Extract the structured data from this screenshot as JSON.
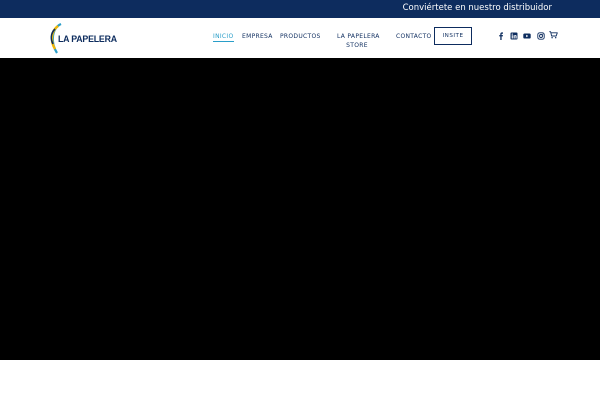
{
  "topbar": {
    "cta": "Conviértete en nuestro distribuidor"
  },
  "logo": {
    "text": "LA PAPELERA"
  },
  "nav": {
    "items": [
      {
        "label": "INICIO",
        "active": true
      },
      {
        "label": "EMPRESA"
      },
      {
        "label": "PRODUCTOS"
      },
      {
        "label_line1": "LA PAPELERA",
        "label_line2": "STORE"
      },
      {
        "label": "CONTACTO"
      }
    ],
    "button": "INSITE"
  },
  "icons": [
    "facebook-icon",
    "linkedin-icon",
    "youtube-icon",
    "instagram-icon",
    "cart-icon"
  ],
  "colors": {
    "brand_navy": "#0d2c5e",
    "active": "#2a9ec9",
    "logo_yellow": "#f2b705",
    "logo_blue": "#2a9ec9",
    "hero": "#000000"
  }
}
